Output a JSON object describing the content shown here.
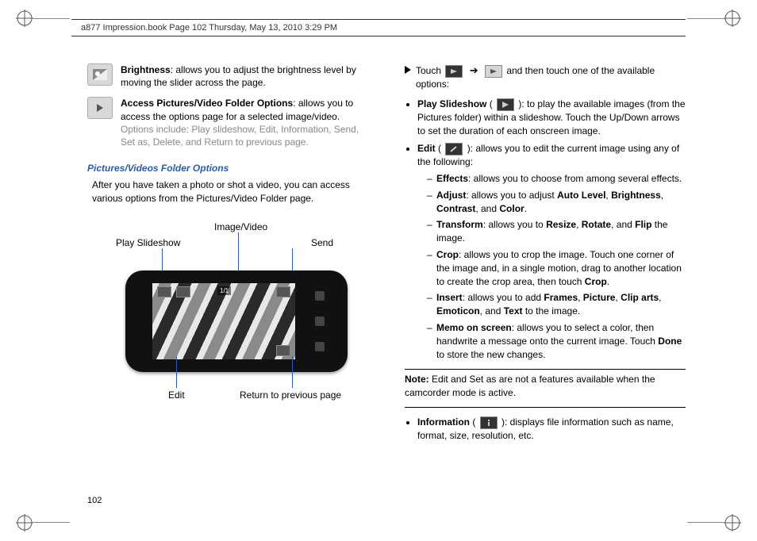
{
  "header": {
    "running": "a877 Impression.book  Page 102  Thursday, May 13, 2010  3:29 PM"
  },
  "page_number": "102",
  "left": {
    "brightness_label": "Brightness",
    "brightness_text": ": allows you to adjust the brightness level by moving the slider across the page.",
    "access_label": "Access Pictures/Video Folder Options",
    "access_text": ": allows you to access the options page for a selected image/video.",
    "access_gray": " Options include: Play slideshow, Edit, Information, Send, Set as, Delete, and Return to previous page.",
    "section_heading": "Pictures/Videos Folder Options",
    "section_para": "After you have taken a photo or shot a video, you can access various options from the Pictures/Video Folder page.",
    "diagram": {
      "play_slideshow": "Play Slideshow",
      "image_video": "Image/Video",
      "send": "Send",
      "edit": "Edit",
      "return": "Return to previous page",
      "counter": "1/1"
    }
  },
  "right": {
    "touch": "Touch",
    "touch_tail": " and then touch one of the available options:",
    "play_slideshow_label": "Play Slideshow",
    "play_slideshow_text": "): to play the available images (from the Pictures folder) within a slideshow. Touch the Up/Down arrows to set the duration of each onscreen image.",
    "edit_label": "Edit",
    "edit_text": "): allows you to edit the current image using any of the following:",
    "effects_label": "Effects",
    "effects_text": ": allows you to choose from among several effects.",
    "adjust_label": "Adjust",
    "adjust_text_pre": ": allows you to adjust ",
    "auto_level": "Auto Level",
    "brightness": "Brightness",
    "contrast": "Contrast",
    "and": ", and ",
    "color": "Color",
    "transform_label": "Transform",
    "transform_text_pre": ": allows you to ",
    "resize": "Resize",
    "rotate": "Rotate",
    "flip": "Flip",
    "transform_tail": " the image.",
    "crop_label": "Crop",
    "crop_text_pre": ": allows you to crop the image. Touch one corner of the image and, in a single motion, drag to another location to create the crop area, then touch ",
    "crop_word": "Crop",
    "other_label": "Insert",
    "other_text_pre": ": allows you to add ",
    "frames": "Frames",
    "picture": "Picture",
    "cliparts": "Clip arts",
    "emoticon": "Emoticon",
    "text": "Text",
    "other_tail": " to the image.",
    "memo_label": "Memo on screen",
    "memo_text_pre": ": allows you to select a color, then handwrite a message onto the current image. Touch ",
    "done": "Done",
    "memo_tail": " to store the new changes.",
    "note_label": "Note:",
    "note_text": "Edit and Set as are not a features available when the camcorder mode is active.",
    "info_label": "Information",
    "info_text": "): displays file information such as name, format, size, resolution, etc."
  }
}
